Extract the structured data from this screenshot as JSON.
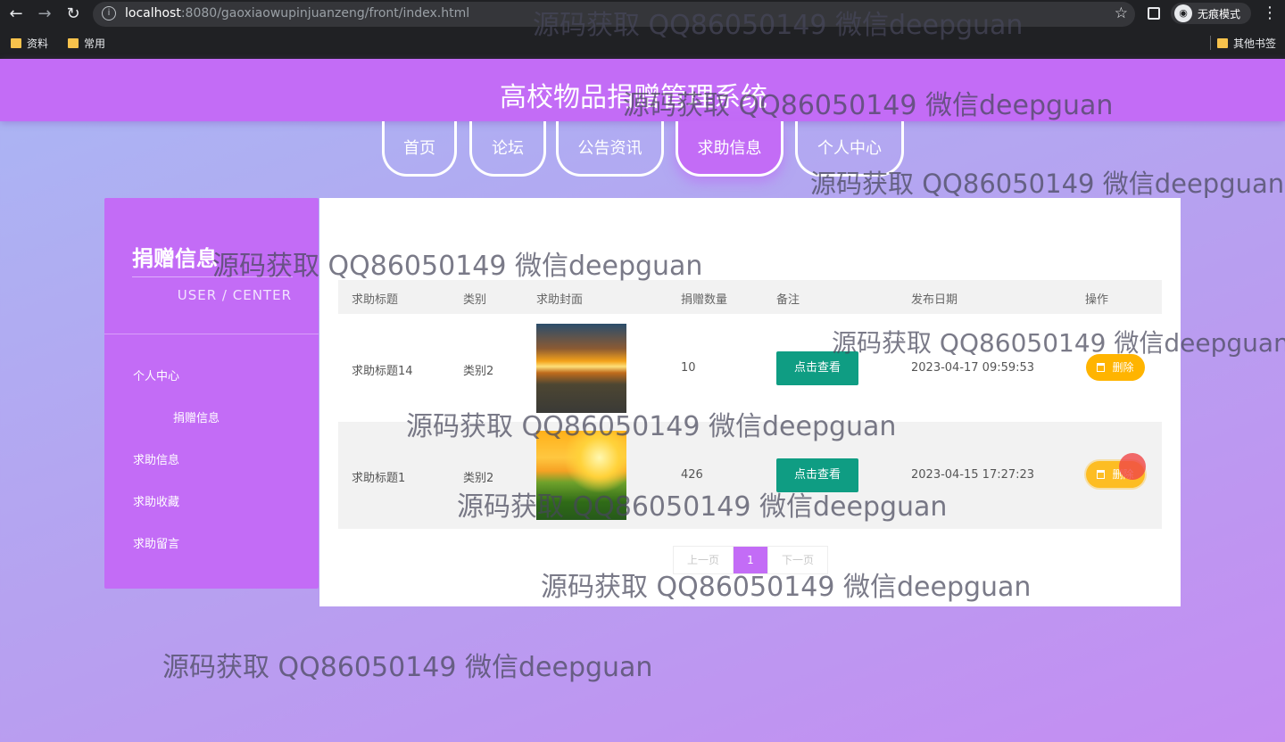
{
  "browser": {
    "url_host": "localhost",
    "url_path": ":8080/gaoxiaowupinjuanzeng/front/index.html",
    "incognito_label": "无痕模式",
    "bookmarks": [
      "资料",
      "常用"
    ],
    "other_bookmarks": "其他书签"
  },
  "site": {
    "title": "高校物品捐赠管理系统"
  },
  "nav": {
    "tabs": [
      "首页",
      "论坛",
      "公告资讯",
      "求助信息",
      "个人中心"
    ],
    "active": "求助信息"
  },
  "sidebar": {
    "title": "捐赠信息",
    "subtitle": "USER / CENTER",
    "items": [
      "个人中心",
      "捐赠信息",
      "求助信息",
      "求助收藏",
      "求助留言"
    ]
  },
  "table": {
    "headers": [
      "求助标题",
      "类别",
      "求助封面",
      "捐赠数量",
      "备注",
      "发布日期",
      "操作"
    ],
    "rows": [
      {
        "title": "求助标题14",
        "category": "类别2",
        "quantity": "10",
        "remark_button": "点击查看",
        "date": "2023-04-17 09:59:53",
        "delete_label": "删除"
      },
      {
        "title": "求助标题1",
        "category": "类别2",
        "quantity": "426",
        "remark_button": "点击查看",
        "date": "2023-04-15 17:27:23",
        "delete_label": "删除"
      }
    ]
  },
  "pagination": {
    "prev": "上一页",
    "current": "1",
    "next": "下一页"
  },
  "watermark": "源码获取 QQ86050149 微信deepguan"
}
